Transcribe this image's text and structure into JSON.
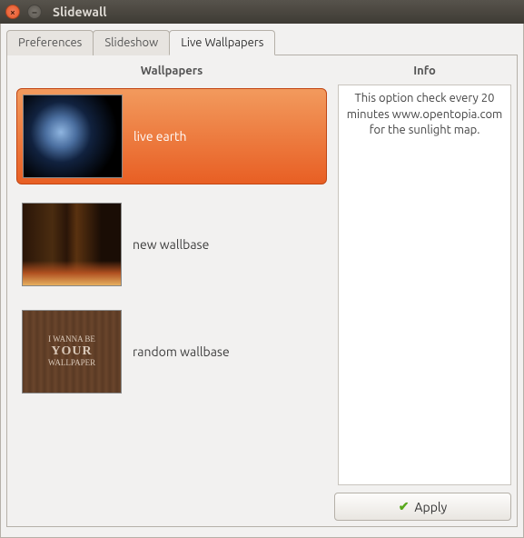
{
  "window": {
    "title": "Slidewall"
  },
  "tabs": [
    {
      "label": "Preferences",
      "active": false
    },
    {
      "label": "Slideshow",
      "active": false
    },
    {
      "label": "Live Wallpapers",
      "active": true
    }
  ],
  "headers": {
    "wallpapers": "Wallpapers",
    "info": "Info"
  },
  "wallpapers": [
    {
      "label": "live earth",
      "selected": true,
      "thumb": "earth"
    },
    {
      "label": "new wallbase",
      "selected": false,
      "thumb": "city"
    },
    {
      "label": "random wallbase",
      "selected": false,
      "thumb": "wood"
    }
  ],
  "wood_thumb_text": {
    "line1": "I WANNA BE",
    "line2": "YOUR",
    "line3": "WALLPAPER"
  },
  "info_text": "This option check every 20 minutes www.opentopia.com for the sunlight map.",
  "buttons": {
    "apply": "Apply"
  }
}
